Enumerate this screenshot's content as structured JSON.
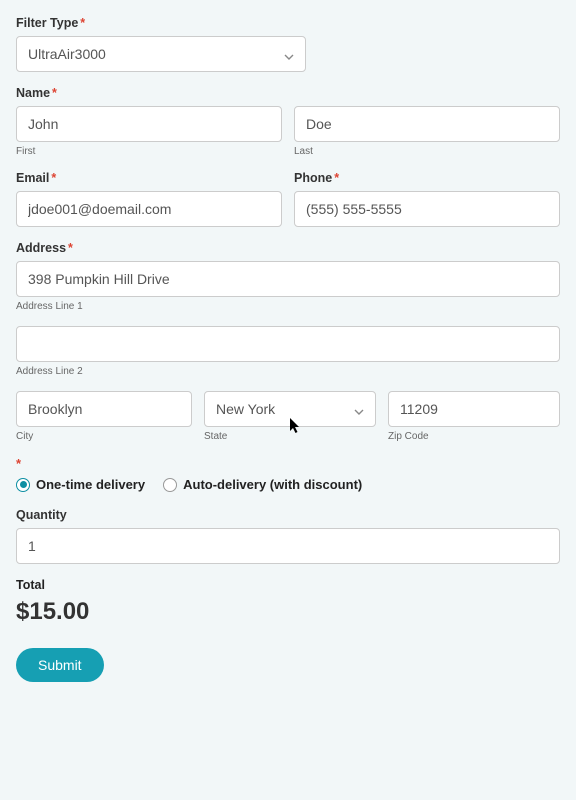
{
  "filterType": {
    "label": "Filter Type",
    "value": "UltraAir3000"
  },
  "name": {
    "label": "Name",
    "first": {
      "value": "John",
      "sub": "First"
    },
    "last": {
      "value": "Doe",
      "sub": "Last"
    }
  },
  "email": {
    "label": "Email",
    "value": "jdoe001@doemail.com"
  },
  "phone": {
    "label": "Phone",
    "value": "(555) 555-5555"
  },
  "address": {
    "label": "Address",
    "line1": {
      "value": "398 Pumpkin Hill Drive",
      "sub": "Address Line 1"
    },
    "line2": {
      "value": "",
      "sub": "Address Line 2"
    },
    "city": {
      "value": "Brooklyn",
      "sub": "City"
    },
    "state": {
      "value": "New York",
      "sub": "State"
    },
    "zip": {
      "value": "11209",
      "sub": "Zip Code"
    }
  },
  "delivery": {
    "option1": "One-time delivery",
    "option2": "Auto-delivery (with discount)"
  },
  "quantity": {
    "label": "Quantity",
    "value": "1"
  },
  "total": {
    "label": "Total",
    "amount": "$15.00"
  },
  "submit": "Submit",
  "asterisk": "*"
}
